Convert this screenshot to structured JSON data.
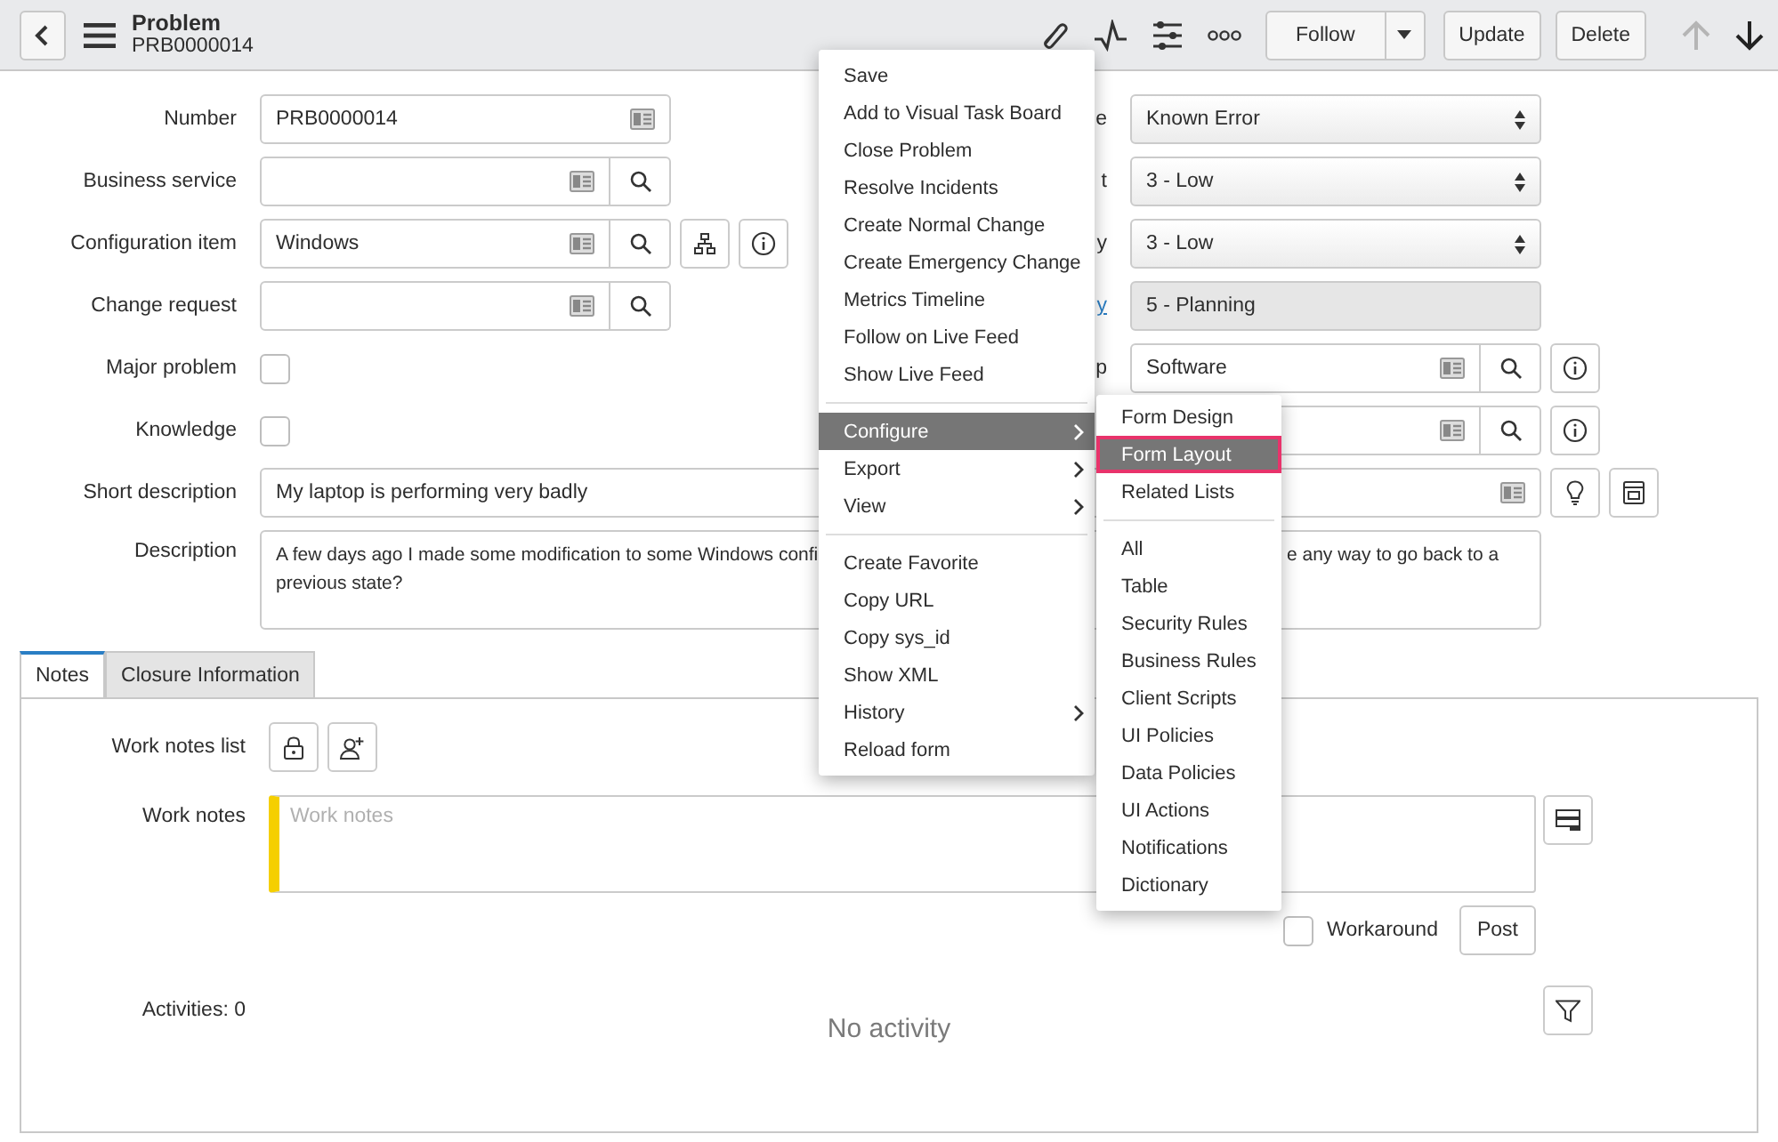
{
  "header": {
    "title": "Problem",
    "subtitle": "PRB0000014",
    "buttons": [
      {
        "label": "Follow",
        "kind": "split"
      },
      {
        "label": "Update",
        "kind": "plain"
      },
      {
        "label": "Delete",
        "kind": "plain"
      }
    ],
    "nav": [
      {
        "kind": "up",
        "disabled": true
      },
      {
        "kind": "down",
        "disabled": false
      }
    ]
  },
  "left_fields": [
    {
      "label": "Number",
      "kind": "text",
      "value": "PRB0000014"
    },
    {
      "label": "Business service",
      "kind": "reference"
    },
    {
      "label": "Configuration item",
      "kind": "reference",
      "value": "Windows",
      "extras": [
        {
          "kind": "tree"
        },
        {
          "kind": "info"
        }
      ]
    },
    {
      "label": "Change request",
      "kind": "reference"
    },
    {
      "label": "Major problem",
      "kind": "checkbox",
      "checked": false
    },
    {
      "label": "Knowledge",
      "kind": "checkbox",
      "checked": false
    }
  ],
  "right_fields": [
    {
      "label": "e",
      "link": false,
      "kind": "select",
      "value": "Known Error"
    },
    {
      "label": "t",
      "link": false,
      "kind": "select",
      "value": "3 - Low"
    },
    {
      "label": "y",
      "link": false,
      "kind": "select",
      "value": "3 - Low"
    },
    {
      "label": "y",
      "link": true,
      "kind": "readonly",
      "value": "5 - Planning"
    },
    {
      "label": "p",
      "link": false,
      "kind": "reference",
      "value": "Software",
      "extras": [
        {
          "kind": "info"
        }
      ]
    },
    {
      "kind": "reference",
      "extras": [
        {
          "kind": "info"
        }
      ]
    }
  ],
  "short_description": {
    "label": "Short description",
    "value": "My laptop is performing very badly",
    "extras": [
      {
        "kind": "bulb"
      },
      {
        "kind": "document"
      }
    ]
  },
  "description": {
    "label": "Description",
    "line1_left": "A few days ago I made some modification to some Windows confi",
    "line1_right": "e any way to go back to a",
    "line2": "previous state?"
  },
  "tabs": [
    {
      "label": "Notes",
      "selected": true
    },
    {
      "label": "Closure Information",
      "selected": false
    }
  ],
  "notes": {
    "work_notes_list_label": "Work notes list",
    "work_notes_label": "Work notes",
    "work_notes_placeholder": "Work notes",
    "workaround": {
      "label": "Workaround",
      "checked": false
    },
    "post_button": "Post",
    "activities_label": "Activities: 0",
    "empty_text": "No activity"
  },
  "context_menu": [
    {
      "kind": "item",
      "label": "Save",
      "highlighted": false,
      "submenu": false
    },
    {
      "kind": "item",
      "label": "Add to Visual Task Board",
      "highlighted": false,
      "submenu": false
    },
    {
      "kind": "item",
      "label": "Close Problem",
      "highlighted": false,
      "submenu": false
    },
    {
      "kind": "item",
      "label": "Resolve Incidents",
      "highlighted": false,
      "submenu": false
    },
    {
      "kind": "item",
      "label": "Create Normal Change",
      "highlighted": false,
      "submenu": false
    },
    {
      "kind": "item",
      "label": "Create Emergency Change",
      "highlighted": false,
      "submenu": false
    },
    {
      "kind": "item",
      "label": "Metrics Timeline",
      "highlighted": false,
      "submenu": false
    },
    {
      "kind": "item",
      "label": "Follow on Live Feed",
      "highlighted": false,
      "submenu": false
    },
    {
      "kind": "item",
      "label": "Show Live Feed",
      "highlighted": false,
      "submenu": false
    },
    {
      "kind": "divider"
    },
    {
      "kind": "item",
      "label": "Configure",
      "highlighted": true,
      "submenu": true
    },
    {
      "kind": "item",
      "label": "Export",
      "highlighted": false,
      "submenu": true
    },
    {
      "kind": "item",
      "label": "View",
      "highlighted": false,
      "submenu": true
    },
    {
      "kind": "divider"
    },
    {
      "kind": "item",
      "label": "Create Favorite",
      "highlighted": false,
      "submenu": false
    },
    {
      "kind": "item",
      "label": "Copy URL",
      "highlighted": false,
      "submenu": false
    },
    {
      "kind": "item",
      "label": "Copy sys_id",
      "highlighted": false,
      "submenu": false
    },
    {
      "kind": "item",
      "label": "Show XML",
      "highlighted": false,
      "submenu": false
    },
    {
      "kind": "item",
      "label": "History",
      "highlighted": false,
      "submenu": true
    },
    {
      "kind": "item",
      "label": "Reload form",
      "highlighted": false,
      "submenu": false
    }
  ],
  "configure_submenu": [
    {
      "kind": "item",
      "label": "Form Design",
      "highlighted": false,
      "outlined": false
    },
    {
      "kind": "item",
      "label": "Form Layout",
      "highlighted": true,
      "outlined": true
    },
    {
      "kind": "item",
      "label": "Related Lists",
      "highlighted": false,
      "outlined": false
    },
    {
      "kind": "divider"
    },
    {
      "kind": "item",
      "label": "All",
      "highlighted": false,
      "outlined": false
    },
    {
      "kind": "item",
      "label": "Table",
      "highlighted": false,
      "outlined": false
    },
    {
      "kind": "item",
      "label": "Security Rules",
      "highlighted": false,
      "outlined": false
    },
    {
      "kind": "item",
      "label": "Business Rules",
      "highlighted": false,
      "outlined": false
    },
    {
      "kind": "item",
      "label": "Client Scripts",
      "highlighted": false,
      "outlined": false
    },
    {
      "kind": "item",
      "label": "UI Policies",
      "highlighted": false,
      "outlined": false
    },
    {
      "kind": "item",
      "label": "Data Policies",
      "highlighted": false,
      "outlined": false
    },
    {
      "kind": "item",
      "label": "UI Actions",
      "highlighted": false,
      "outlined": false
    },
    {
      "kind": "item",
      "label": "Notifications",
      "highlighted": false,
      "outlined": false
    },
    {
      "kind": "item",
      "label": "Dictionary",
      "highlighted": false,
      "outlined": false
    }
  ]
}
